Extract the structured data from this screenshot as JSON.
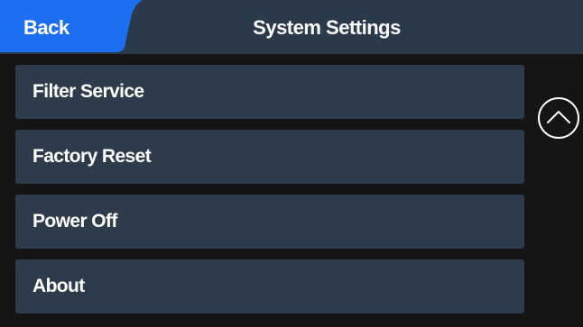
{
  "colors": {
    "background": "#151515",
    "header": "#2b3a4a",
    "accent": "#1d6ff2",
    "menu_item": "#2d3b4b",
    "text": "#ffffff"
  },
  "header": {
    "back_label": "Back",
    "title": "System Settings"
  },
  "menu": {
    "items": [
      {
        "label": "Filter Service"
      },
      {
        "label": "Factory Reset"
      },
      {
        "label": "Power Off"
      },
      {
        "label": "About"
      }
    ]
  },
  "scroll": {
    "up_icon": "chevron-up-circle-icon"
  }
}
